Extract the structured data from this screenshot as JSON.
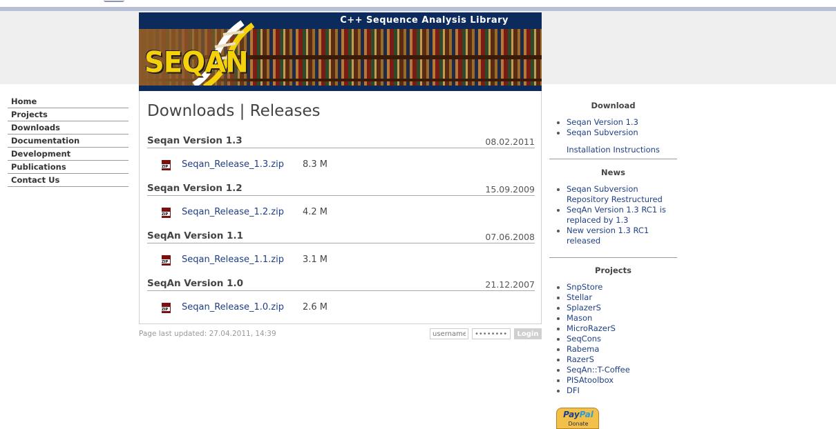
{
  "banner": {
    "subtitle": "C++ Sequence Analysis Library",
    "logo_text": "SEQAN"
  },
  "nav": {
    "items": [
      "Home",
      "Projects",
      "Downloads",
      "Documentation",
      "Development",
      "Publications",
      "Contact Us"
    ]
  },
  "main": {
    "title": "Downloads | Releases",
    "releases": [
      {
        "name": "Seqan Version 1.3",
        "date": "08.02.2011",
        "file": "Seqan_Release_1.3.zip",
        "size": "8.3 M"
      },
      {
        "name": "Seqan Version 1.2",
        "date": "15.09.2009",
        "file": "Seqan_Release_1.2.zip",
        "size": "4.2 M"
      },
      {
        "name": "SeqAn Version 1.1",
        "date": "07.06.2008",
        "file": "Seqan_Release_1.1.zip",
        "size": "3.1 M"
      },
      {
        "name": "SeqAn Version 1.0",
        "date": "21.12.2007",
        "file": "Seqan_Release_1.0.zip",
        "size": "2.6 M"
      }
    ]
  },
  "footer": {
    "updated": "Page last updated: 27.04.2011, 14:39",
    "username_placeholder": "username",
    "password_placeholder": "••••••••",
    "login_label": "Login"
  },
  "sidebar": {
    "download": {
      "title": "Download",
      "items": [
        "Seqan Version 1.3",
        "Seqan Subversion"
      ],
      "install": "Installation Instructions"
    },
    "news": {
      "title": "News",
      "items": [
        "Seqan Subversion Repository Restructured",
        "SeqAn Version 1.3 RC1 is replaced by 1.3",
        "New version 1.3 RC1 released"
      ]
    },
    "projects": {
      "title": "Projects",
      "items": [
        "SnpStore",
        "Stellar",
        "SplazerS",
        "Mason",
        "MicroRazerS",
        "SeqCons",
        "Rabema",
        "RazerS",
        "SeqAn::T-Coffee",
        "PISAtoolbox",
        "DFI"
      ]
    },
    "paypal": {
      "brand_a": "Pay",
      "brand_b": "Pal",
      "donate": "Donate"
    }
  },
  "colors": {
    "link": "#1f3f85",
    "banner_bar": "#0c2a5c",
    "logo_yellow": "#f5d10c"
  }
}
